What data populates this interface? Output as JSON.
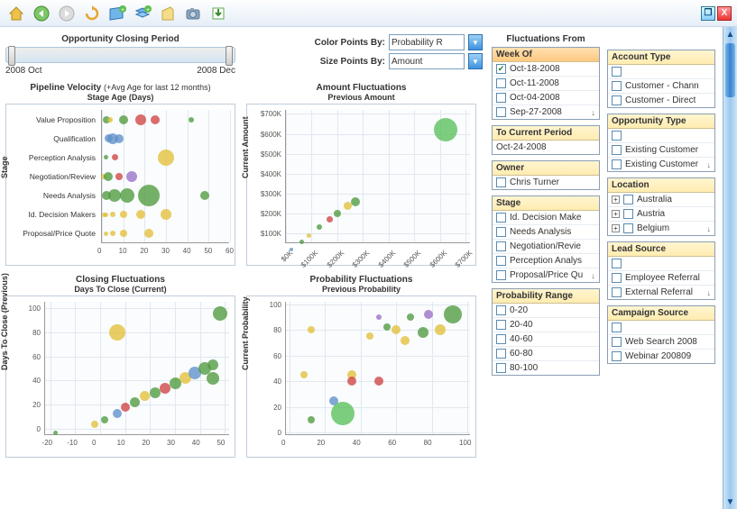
{
  "toolbar": {
    "icons": [
      "home-icon",
      "back-icon",
      "forward-icon",
      "refresh-icon",
      "add-sheet-icon",
      "add-layer-icon",
      "clipboard-icon",
      "camera-icon",
      "export-icon"
    ],
    "maximize": "❐",
    "close": "X"
  },
  "slider": {
    "title": "Opportunity Closing Period",
    "start": "2008 Oct",
    "end": "2008 Dec"
  },
  "controls": {
    "color_label": "Color Points By:",
    "color_value": "Probability R",
    "size_label": "Size Points By:",
    "size_value": "Amount"
  },
  "filters_title": "Fluctuations From",
  "filters_left": [
    {
      "head": "Week Of",
      "selected": true,
      "items": [
        {
          "label": "Oct-18-2008",
          "checked": true
        },
        {
          "label": "Oct-11-2008",
          "checked": false
        },
        {
          "label": "Oct-04-2008",
          "checked": false
        },
        {
          "label": "Sep-27-2008",
          "checked": false,
          "more": true
        }
      ]
    },
    {
      "head": "To Current Period",
      "text_value": "Oct-24-2008"
    },
    {
      "head": "Owner",
      "items": [
        {
          "label": "Chris Turner",
          "checked": false
        }
      ]
    },
    {
      "head": "Stage",
      "items": [
        {
          "label": "Id. Decision Make",
          "checked": false
        },
        {
          "label": "Needs Analysis",
          "checked": false
        },
        {
          "label": "Negotiation/Revie",
          "checked": false
        },
        {
          "label": "Perception Analys",
          "checked": false
        },
        {
          "label": "Proposal/Price Qu",
          "checked": false,
          "more": true
        }
      ]
    },
    {
      "head": "Probability Range",
      "items": [
        {
          "label": "0-20",
          "checked": false
        },
        {
          "label": "20-40",
          "checked": false
        },
        {
          "label": "40-60",
          "checked": false
        },
        {
          "label": "60-80",
          "checked": false
        },
        {
          "label": "80-100",
          "checked": false
        }
      ]
    }
  ],
  "filters_right": [
    {
      "head": "Account Type",
      "items": [
        {
          "label": "",
          "checked": false
        },
        {
          "label": "Customer - Chann",
          "checked": false
        },
        {
          "label": "Customer - Direct",
          "checked": false
        }
      ]
    },
    {
      "head": "Opportunity Type",
      "items": [
        {
          "label": "",
          "checked": false
        },
        {
          "label": "Existing Customer",
          "checked": false
        },
        {
          "label": "Existing Customer",
          "checked": false,
          "more": true
        }
      ]
    },
    {
      "head": "Location",
      "items": [
        {
          "label": "Australia",
          "checked": false,
          "exp": true
        },
        {
          "label": "Austria",
          "checked": false,
          "exp": true
        },
        {
          "label": "Belgium",
          "checked": false,
          "exp": true,
          "more": true
        }
      ]
    },
    {
      "head": "Lead Source",
      "items": [
        {
          "label": "",
          "checked": false
        },
        {
          "label": "Employee Referral",
          "checked": false
        },
        {
          "label": "External Referral",
          "checked": false,
          "more": true
        }
      ]
    },
    {
      "head": "Campaign Source",
      "items": [
        {
          "label": "",
          "checked": false
        },
        {
          "label": "Web Search 2008",
          "checked": false
        },
        {
          "label": "Webinar 200809",
          "checked": false
        }
      ]
    }
  ],
  "chart_data": [
    {
      "type": "bubble",
      "title": "Pipeline Velocity",
      "subtitle": "(+Avg Age for last 12 months)",
      "xlabel": "Stage Age (Days)",
      "ylabel": "Stage",
      "categories": [
        "Value Proposition",
        "Qualification",
        "Perception Analysis",
        "Negotiation/Review",
        "Needs Analysis",
        "Id. Decision Makers",
        "Proposal/Price Quote"
      ],
      "x_ticks": [
        0,
        10,
        20,
        30,
        40,
        50,
        60
      ],
      "series": [
        {
          "cat": 0,
          "x": 2,
          "size": 8,
          "color": "#4f9a3f"
        },
        {
          "cat": 0,
          "x": 4,
          "size": 6,
          "color": "#d7c33b"
        },
        {
          "cat": 0,
          "x": 10,
          "size": 10,
          "color": "#4f9a3f"
        },
        {
          "cat": 0,
          "x": 18,
          "size": 12,
          "color": "#d04343"
        },
        {
          "cat": 0,
          "x": 25,
          "size": 10,
          "color": "#d04343"
        },
        {
          "cat": 0,
          "x": 42,
          "size": 6,
          "color": "#4f9a3f"
        },
        {
          "cat": 1,
          "x": 3,
          "size": 9,
          "color": "#5f8fc9"
        },
        {
          "cat": 1,
          "x": 5,
          "size": 12,
          "color": "#5f8fc9"
        },
        {
          "cat": 1,
          "x": 8,
          "size": 10,
          "color": "#5f8fc9"
        },
        {
          "cat": 2,
          "x": 2,
          "size": 5,
          "color": "#4f9a3f"
        },
        {
          "cat": 2,
          "x": 6,
          "size": 7,
          "color": "#d04343"
        },
        {
          "cat": 2,
          "x": 30,
          "size": 18,
          "color": "#e3bf3a"
        },
        {
          "cat": 3,
          "x": 1,
          "size": 6,
          "color": "#e3bf3a"
        },
        {
          "cat": 3,
          "x": 3,
          "size": 10,
          "color": "#4f9a3f"
        },
        {
          "cat": 3,
          "x": 8,
          "size": 8,
          "color": "#d04343"
        },
        {
          "cat": 3,
          "x": 14,
          "size": 12,
          "color": "#9a6fc7"
        },
        {
          "cat": 4,
          "x": 2,
          "size": 10,
          "color": "#4f9a3f"
        },
        {
          "cat": 4,
          "x": 6,
          "size": 14,
          "color": "#4f9a3f"
        },
        {
          "cat": 4,
          "x": 12,
          "size": 16,
          "color": "#4f9a3f"
        },
        {
          "cat": 4,
          "x": 22,
          "size": 24,
          "color": "#4f9a3f"
        },
        {
          "cat": 4,
          "x": 48,
          "size": 10,
          "color": "#4f9a3f"
        },
        {
          "cat": 5,
          "x": 1,
          "size": 5,
          "color": "#e3bf3a"
        },
        {
          "cat": 5,
          "x": 2,
          "size": 5,
          "color": "#e3bf3a"
        },
        {
          "cat": 5,
          "x": 5,
          "size": 6,
          "color": "#e3bf3a"
        },
        {
          "cat": 5,
          "x": 10,
          "size": 8,
          "color": "#e3bf3a"
        },
        {
          "cat": 5,
          "x": 18,
          "size": 10,
          "color": "#e3bf3a"
        },
        {
          "cat": 5,
          "x": 30,
          "size": 12,
          "color": "#e3bf3a"
        },
        {
          "cat": 6,
          "x": 2,
          "size": 5,
          "color": "#e3bf3a"
        },
        {
          "cat": 6,
          "x": 5,
          "size": 6,
          "color": "#e3bf3a"
        },
        {
          "cat": 6,
          "x": 10,
          "size": 8,
          "color": "#e3bf3a"
        },
        {
          "cat": 6,
          "x": 22,
          "size": 10,
          "color": "#e3bf3a"
        }
      ]
    },
    {
      "type": "scatter",
      "title": "Amount Fluctuations",
      "xlabel": "Previous Amount",
      "ylabel": "Current Amount",
      "x_ticks": [
        "$0K",
        "$100K",
        "$200K",
        "$300K",
        "$400K",
        "$500K",
        "$600K",
        "$700K"
      ],
      "y_ticks": [
        "$100K",
        "$200K",
        "$300K",
        "$400K",
        "$500K",
        "$600K",
        "$700K"
      ],
      "series": [
        {
          "x": 20,
          "y": 20,
          "size": 4,
          "color": "#5f8fc9"
        },
        {
          "x": 60,
          "y": 55,
          "size": 5,
          "color": "#4f9a3f"
        },
        {
          "x": 90,
          "y": 90,
          "size": 5,
          "color": "#e3bf3a"
        },
        {
          "x": 130,
          "y": 130,
          "size": 6,
          "color": "#4f9a3f"
        },
        {
          "x": 170,
          "y": 170,
          "size": 7,
          "color": "#d04343"
        },
        {
          "x": 200,
          "y": 200,
          "size": 8,
          "color": "#4f9a3f"
        },
        {
          "x": 240,
          "y": 240,
          "size": 9,
          "color": "#e3bf3a"
        },
        {
          "x": 270,
          "y": 260,
          "size": 10,
          "color": "#4f9a3f"
        },
        {
          "x": 620,
          "y": 620,
          "size": 26,
          "color": "#5abf5a"
        }
      ],
      "xlim": [
        0,
        720
      ],
      "ylim": [
        50,
        720
      ]
    },
    {
      "type": "scatter",
      "title": "Closing  Fluctuations",
      "xlabel": "Days To Close (Current)",
      "ylabel": "Days To Close (Previous)",
      "x_ticks": [
        -20,
        -10,
        0,
        10,
        20,
        30,
        40,
        50
      ],
      "y_ticks": [
        0,
        20,
        40,
        60,
        80,
        100
      ],
      "series": [
        {
          "x": -18,
          "y": -3,
          "size": 5,
          "color": "#4f9a3f"
        },
        {
          "x": -2,
          "y": 4,
          "size": 8,
          "color": "#e3bf3a"
        },
        {
          "x": 2,
          "y": 8,
          "size": 8,
          "color": "#4f9a3f"
        },
        {
          "x": 7,
          "y": 13,
          "size": 10,
          "color": "#5f8fc9"
        },
        {
          "x": 10,
          "y": 18,
          "size": 10,
          "color": "#d04343"
        },
        {
          "x": 14,
          "y": 22,
          "size": 11,
          "color": "#4f9a3f"
        },
        {
          "x": 18,
          "y": 27,
          "size": 11,
          "color": "#e3bf3a"
        },
        {
          "x": 22,
          "y": 30,
          "size": 12,
          "color": "#4f9a3f"
        },
        {
          "x": 26,
          "y": 34,
          "size": 12,
          "color": "#d04343"
        },
        {
          "x": 30,
          "y": 38,
          "size": 13,
          "color": "#4f9a3f"
        },
        {
          "x": 34,
          "y": 42,
          "size": 13,
          "color": "#e3bf3a"
        },
        {
          "x": 38,
          "y": 46,
          "size": 14,
          "color": "#5f8fc9"
        },
        {
          "x": 42,
          "y": 50,
          "size": 14,
          "color": "#4f9a3f"
        },
        {
          "x": 45,
          "y": 42,
          "size": 14,
          "color": "#4f9a3f"
        },
        {
          "x": 45,
          "y": 53,
          "size": 12,
          "color": "#4f9a3f"
        },
        {
          "x": 48,
          "y": 95,
          "size": 16,
          "color": "#4f9a3f"
        },
        {
          "x": 7,
          "y": 80,
          "size": 18,
          "color": "#e3bf3a"
        }
      ],
      "xlim": [
        -22,
        52
      ],
      "ylim": [
        -5,
        105
      ]
    },
    {
      "type": "scatter",
      "title": "Probability Fluctuations",
      "xlabel": "Previous Probability",
      "ylabel": "Current Probability",
      "x_ticks": [
        0,
        20,
        40,
        60,
        80,
        100
      ],
      "y_ticks": [
        0,
        20,
        40,
        60,
        80,
        100
      ],
      "series": [
        {
          "x": 8,
          "y": 45,
          "size": 8,
          "color": "#e3bf3a"
        },
        {
          "x": 12,
          "y": 10,
          "size": 8,
          "color": "#4f9a3f"
        },
        {
          "x": 25,
          "y": 25,
          "size": 10,
          "color": "#5f8fc9"
        },
        {
          "x": 12,
          "y": 80,
          "size": 8,
          "color": "#e3bf3a"
        },
        {
          "x": 30,
          "y": 15,
          "size": 26,
          "color": "#5abf5a"
        },
        {
          "x": 35,
          "y": 45,
          "size": 10,
          "color": "#e3bf3a"
        },
        {
          "x": 35,
          "y": 40,
          "size": 10,
          "color": "#d04343"
        },
        {
          "x": 45,
          "y": 75,
          "size": 8,
          "color": "#e3bf3a"
        },
        {
          "x": 50,
          "y": 40,
          "size": 10,
          "color": "#d04343"
        },
        {
          "x": 50,
          "y": 90,
          "size": 6,
          "color": "#9a6fc7"
        },
        {
          "x": 55,
          "y": 82,
          "size": 8,
          "color": "#4f9a3f"
        },
        {
          "x": 60,
          "y": 80,
          "size": 10,
          "color": "#e3bf3a"
        },
        {
          "x": 65,
          "y": 72,
          "size": 10,
          "color": "#e3bf3a"
        },
        {
          "x": 68,
          "y": 90,
          "size": 8,
          "color": "#4f9a3f"
        },
        {
          "x": 75,
          "y": 78,
          "size": 12,
          "color": "#4f9a3f"
        },
        {
          "x": 78,
          "y": 92,
          "size": 10,
          "color": "#9a6fc7"
        },
        {
          "x": 85,
          "y": 80,
          "size": 12,
          "color": "#e3bf3a"
        },
        {
          "x": 92,
          "y": 92,
          "size": 20,
          "color": "#4f9a3f"
        }
      ],
      "xlim": [
        -2,
        102
      ],
      "ylim": [
        -2,
        102
      ]
    }
  ]
}
